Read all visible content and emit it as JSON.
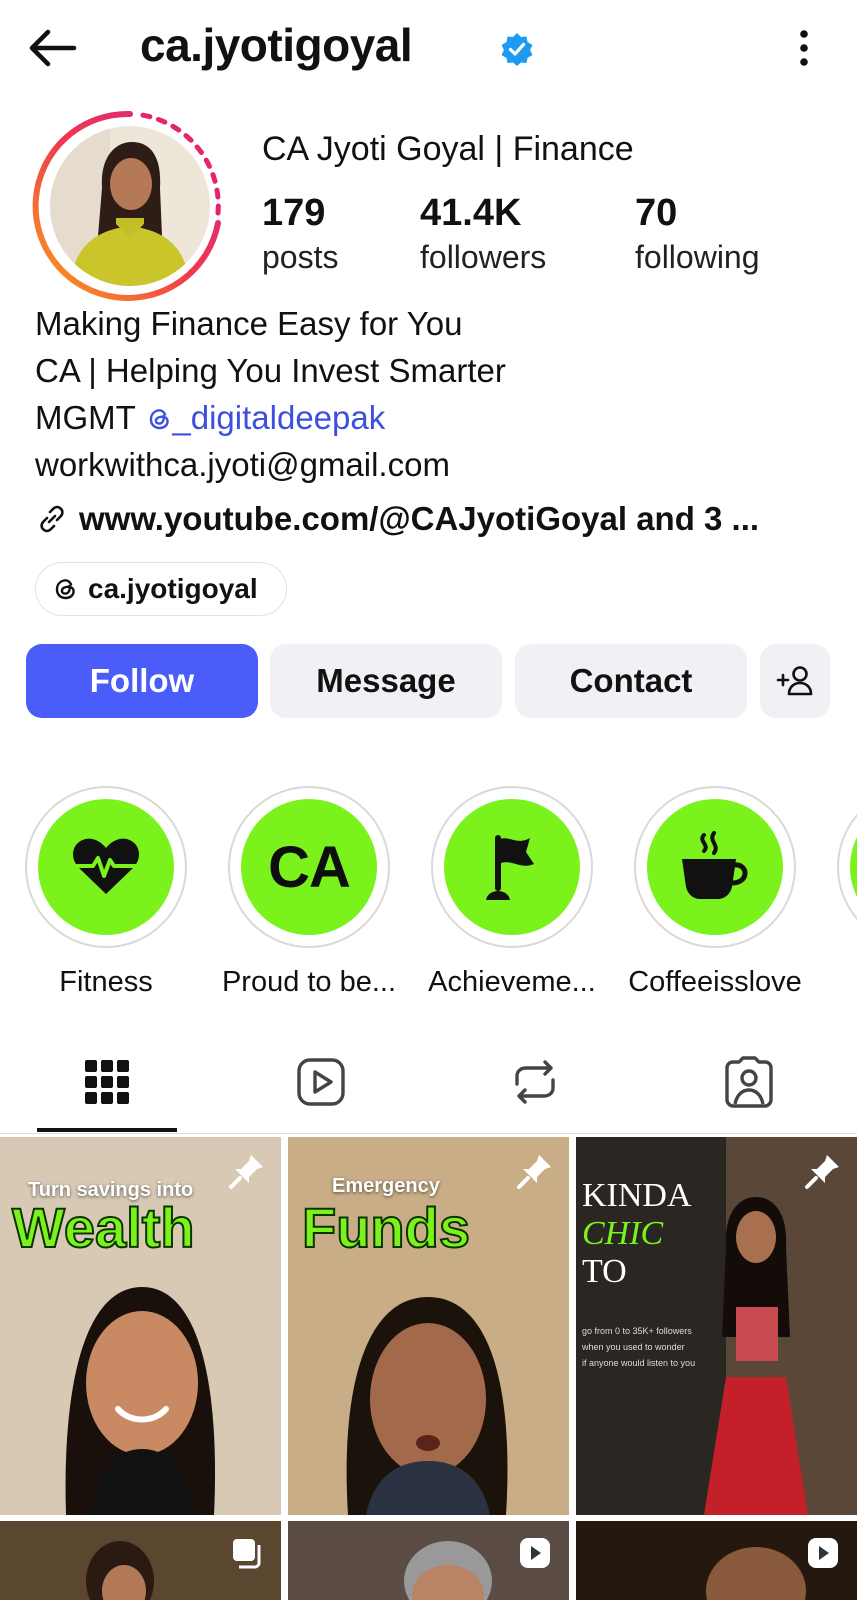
{
  "header": {
    "username": "ca.jyotigoyal",
    "verified": true
  },
  "profile": {
    "full_name": "CA Jyoti Goyal | Finance",
    "stats": [
      {
        "value": "179",
        "label": "posts"
      },
      {
        "value": "41.4K",
        "label": "followers"
      },
      {
        "value": "70",
        "label": "following"
      }
    ],
    "bio_lines": [
      "Making Finance Easy for You",
      "CA | Helping You Invest Smarter"
    ],
    "bio_mgmt_prefix": "MGMT",
    "bio_mgmt_mention": "_digitaldeepak",
    "bio_email": "workwithca.jyoti@gmail.com",
    "link_text": "www.youtube.com/@CAJyotiGoyal and 3 ...",
    "threads_handle": "ca.jyotigoyal"
  },
  "actions": {
    "follow": "Follow",
    "message": "Message",
    "contact": "Contact"
  },
  "highlights": [
    {
      "label": "Fitness",
      "icon": "heart-pulse-icon"
    },
    {
      "label": "Proud to be...",
      "icon": "ca-text",
      "text": "CA"
    },
    {
      "label": "Achieveme...",
      "icon": "flag-icon"
    },
    {
      "label": "Coffeeisslove",
      "icon": "coffee-cup-icon"
    }
  ],
  "tabs": [
    {
      "name": "posts",
      "icon": "grid-icon",
      "active": true
    },
    {
      "name": "reels",
      "icon": "reels-icon"
    },
    {
      "name": "reposts",
      "icon": "repost-icon"
    },
    {
      "name": "tagged",
      "icon": "tagged-person-icon"
    }
  ],
  "posts": [
    {
      "small": "Turn savings into",
      "big": "Wealth",
      "pinned": true
    },
    {
      "small": "Emergency",
      "big": "Funds",
      "pinned": true
    },
    {
      "title_lines": [
        "KINDA",
        "CHIC",
        "TO"
      ],
      "sub_lines": [
        "go from 0 to 35K+ followers",
        "when you used to wonder",
        "if anyone would listen to you"
      ],
      "pinned": true
    }
  ],
  "colors": {
    "accent": "#4a5df9",
    "highlight_green": "#7cf21d",
    "mention": "#3d4fe0",
    "verified": "#1d9bf0"
  }
}
